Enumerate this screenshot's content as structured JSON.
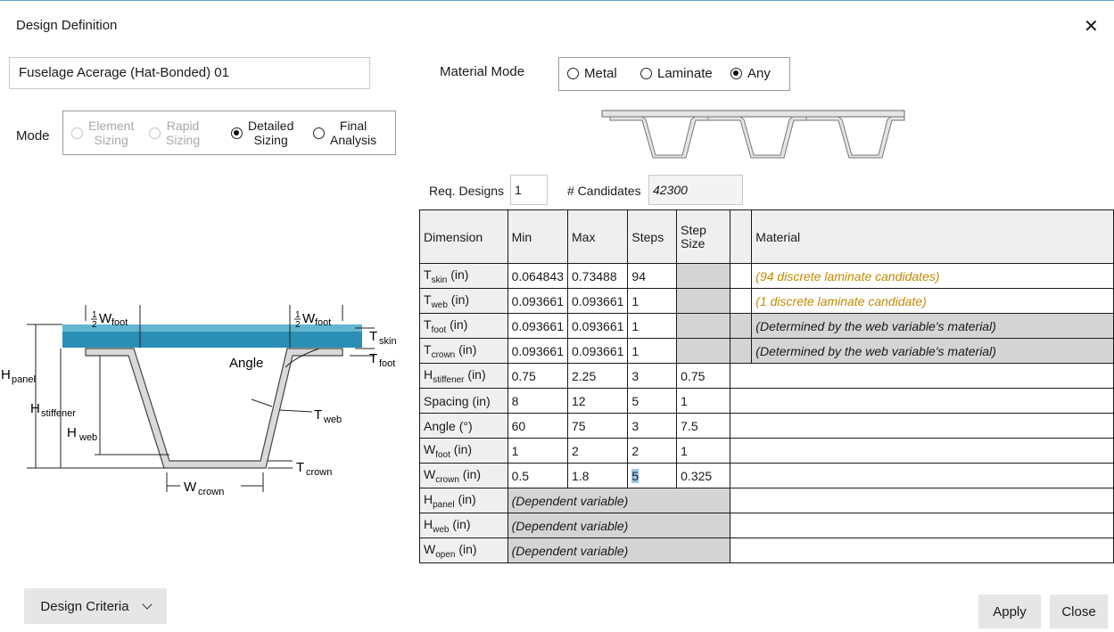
{
  "window": {
    "title": "Design Definition",
    "close_icon": "close-icon"
  },
  "design_name": "Fuselage Acerage (Hat-Bonded) 01",
  "material_mode": {
    "label": "Material Mode",
    "options": [
      "Metal",
      "Laminate",
      "Any"
    ],
    "selected": "Any"
  },
  "mode": {
    "label": "Mode",
    "options": [
      {
        "line1": "Element",
        "line2": "Sizing",
        "enabled": false
      },
      {
        "line1": "Rapid",
        "line2": "Sizing",
        "enabled": false
      },
      {
        "line1": "Detailed",
        "line2": "Sizing",
        "enabled": true
      },
      {
        "line1": "Final",
        "line2": "Analysis",
        "enabled": true
      }
    ],
    "selected": "Detailed Sizing"
  },
  "req_designs": {
    "label": "Req. Designs",
    "value": "1"
  },
  "candidates": {
    "label": "# Candidates",
    "value": "42300"
  },
  "table": {
    "headers": {
      "dimension": "Dimension",
      "min": "Min",
      "max": "Max",
      "steps": "Steps",
      "step_size_1": "Step",
      "step_size_2": "Size",
      "material": "Material"
    },
    "rows": [
      {
        "name": "T",
        "sub": "skin",
        "unit": " (in)",
        "min": "0.064843",
        "max": "0.73488",
        "steps": "94",
        "step_size": "",
        "material": "(94 discrete laminate candidates)"
      },
      {
        "name": "T",
        "sub": "web",
        "unit": " (in)",
        "min": "0.093661",
        "max": "0.093661",
        "steps": "1",
        "step_size": "",
        "material": "(1 discrete laminate candidate)"
      },
      {
        "name": "T",
        "sub": "foot",
        "unit": " (in)",
        "min": "0.093661",
        "max": "0.093661",
        "steps": "1",
        "step_size": "",
        "material": "(Determined by the web variable's material)"
      },
      {
        "name": "T",
        "sub": "crown",
        "unit": " (in)",
        "min": "0.093661",
        "max": "0.093661",
        "steps": "1",
        "step_size": "",
        "material": "(Determined by the web variable's material)"
      },
      {
        "name": "H",
        "sub": "stiffener",
        "unit": " (in)",
        "min": "0.75",
        "max": "2.25",
        "steps": "3",
        "step_size": "0.75"
      },
      {
        "name": "Spacing",
        "sub": "",
        "unit": " (in)",
        "min": "8",
        "max": "12",
        "steps": "5",
        "step_size": "1"
      },
      {
        "name": "Angle",
        "sub": "",
        "unit": " (°)",
        "min": "60",
        "max": "75",
        "steps": "3",
        "step_size": "7.5"
      },
      {
        "name": "W",
        "sub": "foot",
        "unit": " (in)",
        "min": "1",
        "max": "2",
        "steps": "2",
        "step_size": "1"
      },
      {
        "name": "W",
        "sub": "crown",
        "unit": " (in)",
        "min": "0.5",
        "max": "1.8",
        "steps": "5",
        "step_size": "0.325"
      },
      {
        "name": "H",
        "sub": "panel",
        "unit": " (in)",
        "dependent": "(Dependent variable)"
      },
      {
        "name": "H",
        "sub": "web",
        "unit": " (in)",
        "dependent": "(Dependent variable)"
      },
      {
        "name": "W",
        "sub": "open",
        "unit": " (in)",
        "dependent": "(Dependent variable)"
      }
    ]
  },
  "diagram": {
    "half": "1",
    "two": "2",
    "w_foot_left": {
      "main": "W",
      "sub": "foot"
    },
    "w_foot_right": {
      "main": "W",
      "sub": "foot"
    },
    "t_skin": {
      "main": "T",
      "sub": "skin"
    },
    "t_foot": {
      "main": "T",
      "sub": "foot"
    },
    "angle": "Angle",
    "h_panel": {
      "main": "H",
      "sub": "panel"
    },
    "h_stiffener": {
      "main": "H",
      "sub": "stiffener"
    },
    "h_web": {
      "main": "H",
      "sub": "web"
    },
    "t_web": {
      "main": "T",
      "sub": "web"
    },
    "t_crown": {
      "main": "T",
      "sub": "crown"
    },
    "w_crown": {
      "main": "W",
      "sub": "crown"
    },
    "skin_color": "#2a8fb5"
  },
  "buttons": {
    "design_criteria": "Design Criteria",
    "apply": "Apply",
    "close": "Close"
  }
}
